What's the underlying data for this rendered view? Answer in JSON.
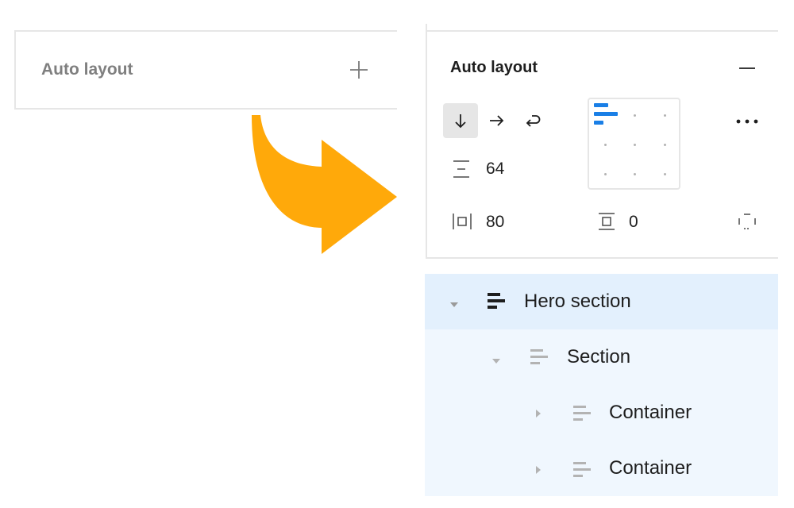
{
  "left_panel": {
    "title": "Auto layout",
    "add_icon": "plus-icon"
  },
  "right_panel": {
    "title": "Auto layout",
    "remove_icon": "minus-icon",
    "direction_buttons": [
      {
        "name": "vertical",
        "icon": "arrow-down-icon",
        "active": true
      },
      {
        "name": "horizontal",
        "icon": "arrow-right-icon",
        "active": false
      },
      {
        "name": "wrap",
        "icon": "wrap-icon",
        "active": false
      }
    ],
    "gap": {
      "icon": "vertical-gap-icon",
      "value": "64"
    },
    "horizontal_padding": {
      "icon": "horizontal-padding-icon",
      "value": "80"
    },
    "vertical_padding": {
      "icon": "vertical-padding-icon",
      "value": "0"
    },
    "alignment": "top-left",
    "more_icon": "more-options-icon",
    "padding_toggle_icon": "individual-padding-icon"
  },
  "arrow": {
    "color": "#FFA90A"
  },
  "layers": [
    {
      "label": "Hero section",
      "expanded": true,
      "selected": true
    },
    {
      "label": "Section",
      "expanded": true,
      "selected": false
    },
    {
      "label": "Container",
      "expanded": false,
      "selected": false
    },
    {
      "label": "Container",
      "expanded": false,
      "selected": false
    }
  ],
  "colors": {
    "accent": "#1A7FE6",
    "selected_row": "#E3F0FD",
    "child_row": "#F0F7FE",
    "divider": "#E6E6E6"
  }
}
